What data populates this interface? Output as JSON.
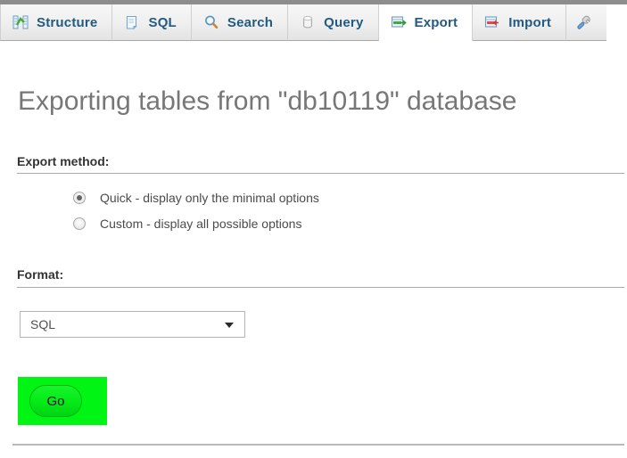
{
  "window": {
    "app": "phpMyAdmin"
  },
  "tabs": [
    {
      "id": "structure",
      "label": "Structure",
      "icon": "structure-icon",
      "active": false
    },
    {
      "id": "sql",
      "label": "SQL",
      "icon": "sql-icon",
      "active": false
    },
    {
      "id": "search",
      "label": "Search",
      "icon": "search-icon",
      "active": false
    },
    {
      "id": "query",
      "label": "Query",
      "icon": "query-icon",
      "active": false
    },
    {
      "id": "export",
      "label": "Export",
      "icon": "export-icon",
      "active": true
    },
    {
      "id": "import",
      "label": "Import",
      "icon": "import-icon",
      "active": false
    },
    {
      "id": "operations",
      "label": "",
      "icon": "wrench-icon",
      "active": false
    }
  ],
  "page": {
    "title": "Exporting tables from \"db10119\" database",
    "database_name": "db10119"
  },
  "export_method": {
    "legend": "Export method:",
    "selected": "quick",
    "options": [
      {
        "id": "quick",
        "label": "Quick - display only the minimal options",
        "checked": true
      },
      {
        "id": "custom",
        "label": "Custom - display all possible options",
        "checked": false
      }
    ]
  },
  "format": {
    "legend": "Format:",
    "selected_value": "SQL",
    "options": [
      "SQL"
    ],
    "arrow_icon": "chevron-down-icon"
  },
  "actions": {
    "go_label": "Go",
    "go_highlight_color": "#00f514"
  },
  "colors": {
    "tab_text": "#235a81",
    "title_text": "#777777",
    "legend_text": "#333333",
    "body_text": "#4b4b4b",
    "highlight_green": "#00f514",
    "button_green": "#05ec19"
  }
}
